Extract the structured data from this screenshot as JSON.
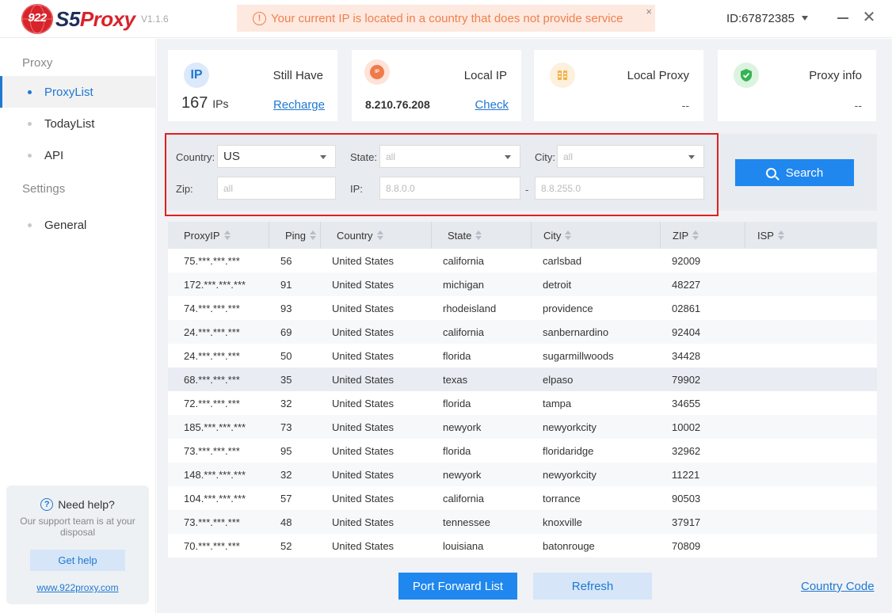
{
  "app": {
    "logo_number": "922",
    "logo_s5": "S5",
    "logo_proxy": "Proxy",
    "version": "V1.1.6",
    "warning": "Your current IP is located in a country that does not provide service",
    "warning_close": "×",
    "user_id": "ID:67872385",
    "close_glyph": "✕"
  },
  "sidebar": {
    "proxy_group": "Proxy",
    "items": [
      {
        "label": "ProxyList"
      },
      {
        "label": "TodayList"
      },
      {
        "label": "API"
      }
    ],
    "settings_group": "Settings",
    "settings_items": [
      {
        "label": "General"
      }
    ],
    "help": {
      "title": "Need help?",
      "subtitle": "Our support team is at your disposal",
      "button": "Get help",
      "link": "www.922proxy.com"
    }
  },
  "cards": [
    {
      "icon": "IP",
      "title": "Still Have",
      "value_num": "167",
      "value_unit": "IPs",
      "link": "Recharge"
    },
    {
      "icon": "IP",
      "title": "Local IP",
      "value": "8.210.76.208",
      "link": "Check"
    },
    {
      "title": "Local Proxy",
      "value": "--"
    },
    {
      "title": "Proxy info",
      "value": "--"
    }
  ],
  "filters": {
    "country_label": "Country:",
    "country_value": "US",
    "state_label": "State:",
    "state_value": "all",
    "city_label": "City:",
    "city_value": "all",
    "zip_label": "Zip:",
    "zip_placeholder": "all",
    "ip_label": "IP:",
    "ip_from_placeholder": "8.8.0.0",
    "ip_separator": "-",
    "ip_to_placeholder": "8.8.255.0",
    "search_button": "Search"
  },
  "table": {
    "columns": [
      "ProxyIP",
      "Ping",
      "Country",
      "State",
      "City",
      "ZIP",
      "ISP"
    ],
    "rows": [
      [
        "75.***.***.***",
        "56",
        "United States",
        "california",
        "carlsbad",
        "92009",
        ""
      ],
      [
        "172.***.***.***",
        "91",
        "United States",
        "michigan",
        "detroit",
        "48227",
        ""
      ],
      [
        "74.***.***.***",
        "93",
        "United States",
        "rhodeisland",
        "providence",
        "02861",
        ""
      ],
      [
        "24.***.***.***",
        "69",
        "United States",
        "california",
        "sanbernardino",
        "92404",
        ""
      ],
      [
        "24.***.***.***",
        "50",
        "United States",
        "florida",
        "sugarmillwoods",
        "34428",
        ""
      ],
      [
        "68.***.***.***",
        "35",
        "United States",
        "texas",
        "elpaso",
        "79902",
        ""
      ],
      [
        "72.***.***.***",
        "32",
        "United States",
        "florida",
        "tampa",
        "34655",
        ""
      ],
      [
        "185.***.***.***",
        "73",
        "United States",
        "newyork",
        "newyorkcity",
        "10002",
        ""
      ],
      [
        "73.***.***.***",
        "95",
        "United States",
        "florida",
        "floridaridge",
        "32962",
        ""
      ],
      [
        "148.***.***.***",
        "32",
        "United States",
        "newyork",
        "newyorkcity",
        "11221",
        ""
      ],
      [
        "104.***.***.***",
        "57",
        "United States",
        "california",
        "torrance",
        "90503",
        ""
      ],
      [
        "73.***.***.***",
        "48",
        "United States",
        "tennessee",
        "knoxville",
        "37917",
        ""
      ],
      [
        "70.***.***.***",
        "52",
        "United States",
        "louisiana",
        "batonrouge",
        "70809",
        ""
      ]
    ]
  },
  "footer": {
    "port_forward": "Port Forward List",
    "refresh": "Refresh",
    "country_code": "Country Code"
  },
  "colors": {
    "accent": "#1f87ee",
    "brand_red": "#d8232a",
    "warning_bg": "#fde9df",
    "warning_text": "#f08050",
    "highlight_frame": "#e02020"
  },
  "icons": {
    "card_ip": "ip-badge-icon",
    "card_local_ip": "location-ip-icon",
    "card_local_proxy": "proxy-server-icon",
    "card_proxy_info": "shield-check-icon"
  }
}
